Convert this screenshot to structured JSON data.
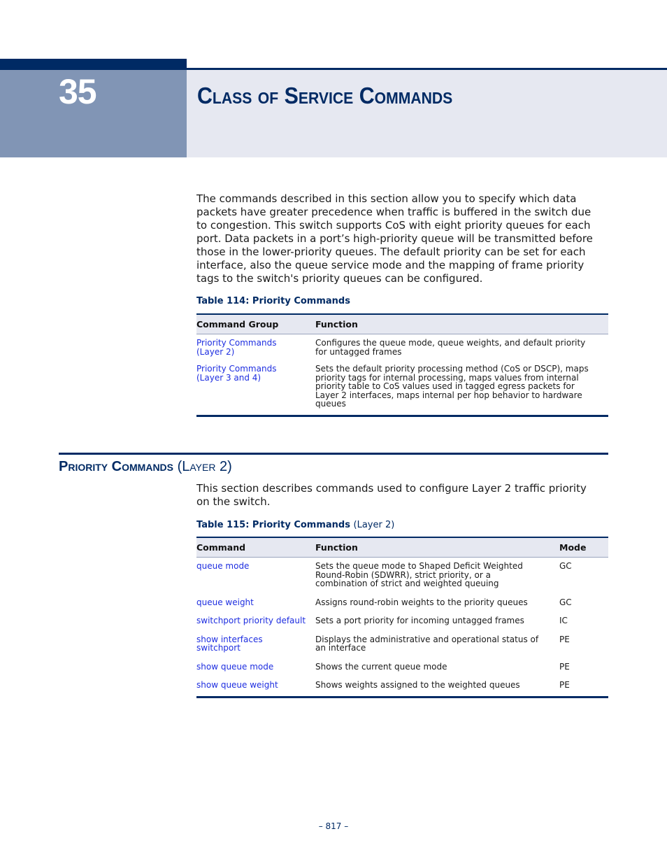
{
  "chapter": {
    "number": "35",
    "title": "Class of Service Commands"
  },
  "intro": {
    "lines": [
      "The commands described in this section allow you to specify which data",
      "packets have greater precedence when traffic is buffered in the switch due",
      "to congestion. This switch supports CoS with eight priority queues for each",
      "port. Data packets in a port’s high-priority queue will be transmitted before",
      "those in the lower-priority queues. The default priority can be set for each",
      "interface, also the queue service mode and the mapping of frame priority",
      "tags to the switch's priority queues can be configured."
    ]
  },
  "table114": {
    "caption": "Table 114: Priority Commands",
    "headers": [
      "Command Group",
      "Function"
    ],
    "rows": [
      {
        "group_lines": [
          "Priority Commands",
          "(Layer 2)"
        ],
        "function_lines": [
          "Configures the queue mode, queue weights, and default priority",
          "for untagged frames"
        ]
      },
      {
        "group_lines": [
          "Priority Commands",
          "(Layer 3 and 4)"
        ],
        "function_lines": [
          "Sets the default priority processing method (CoS or DSCP), maps",
          "priority tags for internal processing, maps values from internal",
          "priority table to CoS values used in tagged egress packets for",
          "Layer 2 interfaces, maps internal per hop behavior to hardware",
          "queues"
        ]
      }
    ]
  },
  "section": {
    "title_main": "Priority Commands",
    "title_sub": "(Layer 2)",
    "description_lines": [
      "This section describes commands used to configure Layer 2 traffic priority",
      "on the switch."
    ]
  },
  "table115": {
    "caption_bold": "Table 115: Priority Commands",
    "caption_normal": "(Layer 2)",
    "headers": [
      "Command",
      "Function",
      "Mode"
    ],
    "rows": [
      {
        "command_lines": [
          "queue mode"
        ],
        "function_lines": [
          "Sets the queue mode to Shaped Deficit Weighted",
          "Round-Robin (SDWRR), strict priority, or a",
          "combination of strict and weighted queuing"
        ],
        "mode": "GC"
      },
      {
        "command_lines": [
          "queue weight"
        ],
        "function_lines": [
          "Assigns round-robin weights to the priority queues"
        ],
        "mode": "GC"
      },
      {
        "command_lines": [
          "switchport priority default"
        ],
        "function_lines": [
          "Sets a port priority for incoming untagged frames"
        ],
        "mode": "IC"
      },
      {
        "command_lines": [
          "show interfaces",
          "switchport"
        ],
        "function_lines": [
          "Displays the administrative and operational status of",
          "an interface"
        ],
        "mode": "PE"
      },
      {
        "command_lines": [
          "show queue mode"
        ],
        "function_lines": [
          "Shows the current queue mode"
        ],
        "mode": "PE"
      },
      {
        "command_lines": [
          "show queue weight"
        ],
        "function_lines": [
          "Shows weights assigned to the weighted queues"
        ],
        "mode": "PE"
      }
    ]
  },
  "footer": {
    "page_number": "–  817  –"
  }
}
